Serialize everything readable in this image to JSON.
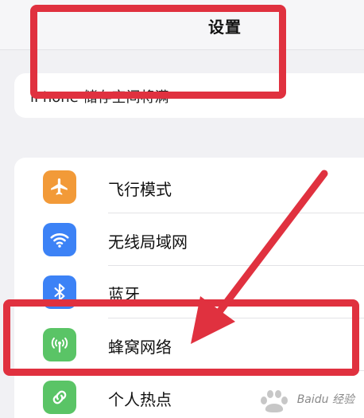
{
  "nav": {
    "title": "设置"
  },
  "storage_banner": {
    "text": "iPhone 储存空间将满"
  },
  "settings_rows": [
    {
      "label": "飞行模式",
      "icon": "airplane-icon",
      "color": "#f29a38"
    },
    {
      "label": "无线局域网",
      "icon": "wifi-icon",
      "color": "#3c82f6"
    },
    {
      "label": "蓝牙",
      "icon": "bluetooth-icon",
      "color": "#3c82f6"
    },
    {
      "label": "蜂窝网络",
      "icon": "cellular-antenna-icon",
      "color": "#5ac466"
    },
    {
      "label": "个人热点",
      "icon": "personal-hotspot-icon",
      "color": "#5ac466"
    }
  ],
  "annotations": {
    "color": "#e0313f"
  },
  "watermark": {
    "text": "Baidu 经验"
  }
}
